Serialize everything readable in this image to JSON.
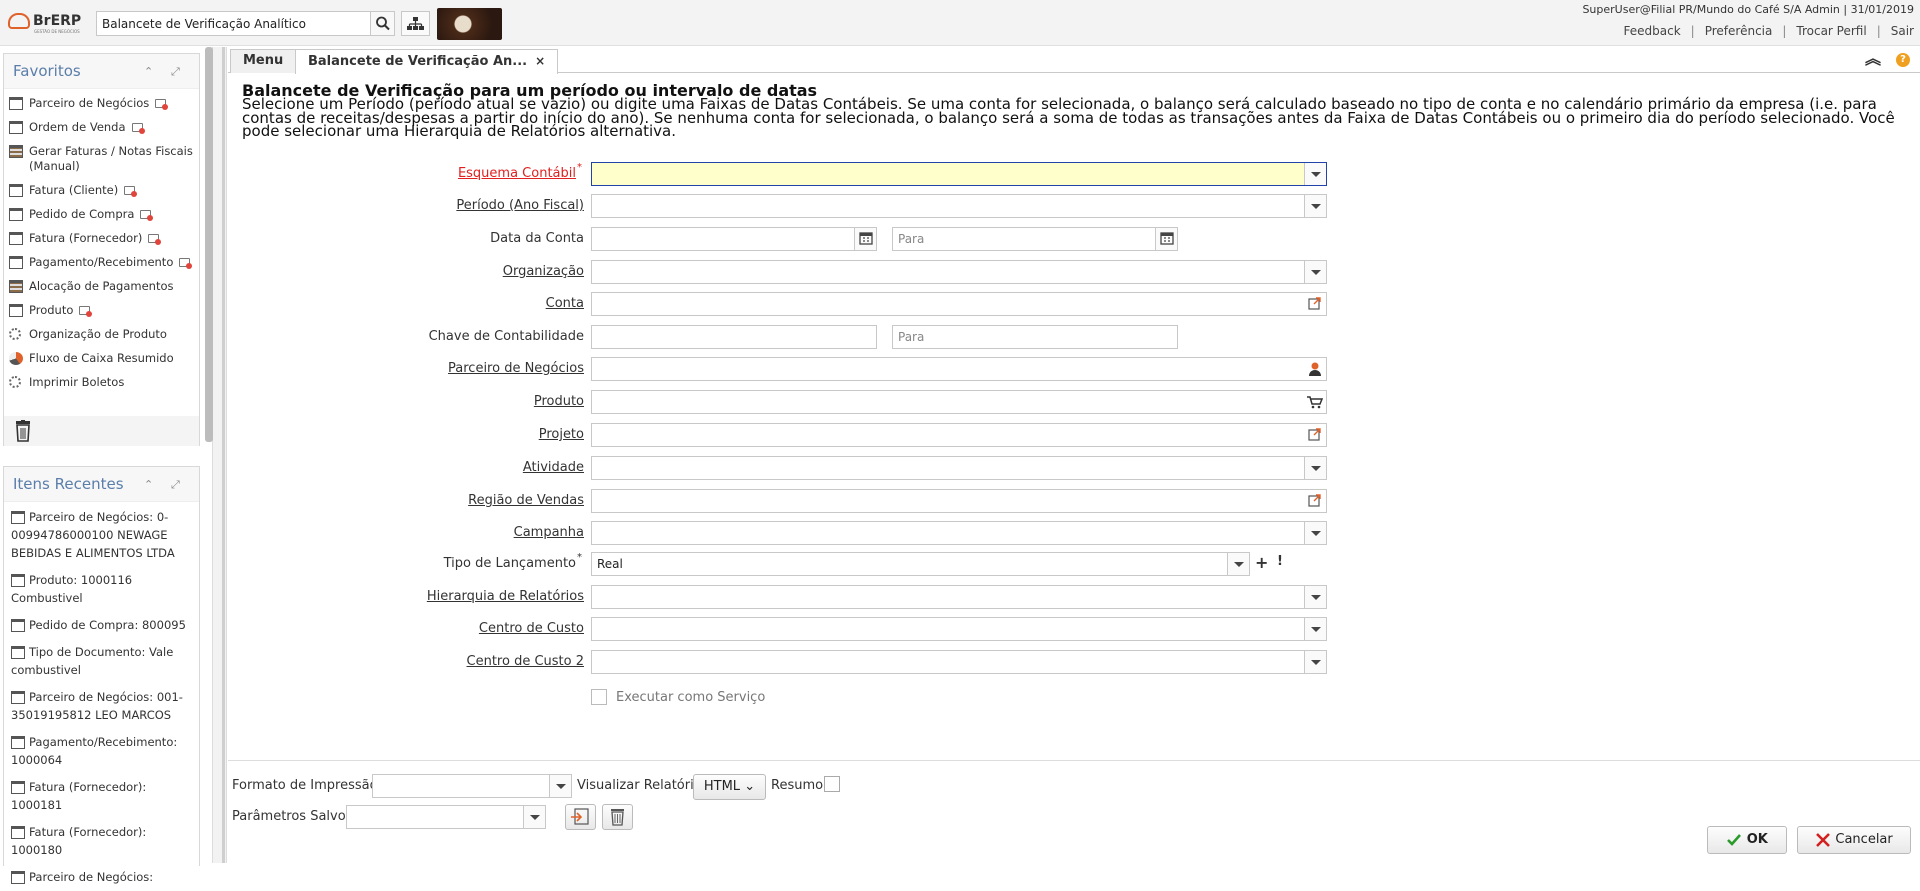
{
  "header": {
    "logo_text": "BrERP",
    "logo_subtext": "GESTÃO DE NEGÓCIOS",
    "search_value": "Balancete de Verificação Analítico",
    "user_info": "SuperUser@Filial PR/Mundo do Café S/A Admin | 31/01/2019",
    "links": [
      "Feedback",
      "Preferência",
      "Trocar Perfil",
      "Sair"
    ],
    "separator": "|"
  },
  "favorites": {
    "title": "Favoritos",
    "items": [
      {
        "label": "Parceiro de Negócios",
        "icon": "window-icon"
      },
      {
        "label": "Ordem de Venda",
        "icon": "window-icon"
      },
      {
        "label": "Gerar Faturas / Notas Fiscais (Manual)",
        "icon": "form-icon"
      },
      {
        "label": "Fatura (Cliente)",
        "icon": "window-icon"
      },
      {
        "label": "Pedido de Compra",
        "icon": "window-icon"
      },
      {
        "label": "Fatura (Fornecedor)",
        "icon": "window-icon"
      },
      {
        "label": "Pagamento/Recebimento",
        "icon": "window-icon"
      },
      {
        "label": "Alocação de Pagamentos",
        "icon": "form-icon"
      },
      {
        "label": "Produto",
        "icon": "window-icon"
      },
      {
        "label": "Organização de Produto",
        "icon": "process-gear-icon"
      },
      {
        "label": "Fluxo de Caixa Resumido",
        "icon": "report-pie-icon"
      },
      {
        "label": "Imprimir Boletos",
        "icon": "process-gear-icon"
      }
    ]
  },
  "recent": {
    "title": "Itens Recentes",
    "items": [
      "Parceiro de Negócios: 0-00994786000100 NEWAGE BEBIDAS E ALIMENTOS LTDA",
      "Produto: 1000116 Combustivel",
      "Pedido de Compra: 800095",
      "Tipo de Documento: Vale combustivel",
      "Parceiro de Negócios: 001-35019195812 LEO MARCOS",
      "Pagamento/Recebimento: 1000064",
      "Fatura (Fornecedor): 1000181",
      "Fatura (Fornecedor): 1000180",
      "Parceiro de Negócios:"
    ]
  },
  "tabs": [
    {
      "label": "Menu"
    },
    {
      "label": "Balancete de Verificação An..."
    }
  ],
  "close_glyph": "×",
  "help_glyph": "?",
  "collapse_glyph": "︽",
  "description": {
    "title": "Balancete de Verificação para um período ou intervalo de datas",
    "text": "Selecione um Período (período atual se vazio) ou digite uma Faixas de Datas Contábeis. Se uma conta for selecionada, o balanço será calculado baseado no tipo de conta e no calendário primário da empresa (i.e. para contas de receitas/despesas a partir do início do ano). Se nenhuma conta for selecionada, o balanço será a soma de todas as transações antes da Faixa de Datas Contábeis ou o primeiro dia do período selecionado. Você pode selecionar uma Hierarquia de Relatórios alternativa."
  },
  "form": {
    "esquema": "Esquema Contábil",
    "periodo": "Período (Ano Fiscal)",
    "data_conta": "Data da Conta",
    "para_placeholder": "Para",
    "organizacao": "Organização",
    "conta": "Conta",
    "chave": "Chave de Contabilidade",
    "parceiro": "Parceiro de Negócios",
    "produto": "Produto",
    "projeto": "Projeto",
    "atividade": "Atividade",
    "regiao": "Região de Vendas",
    "campanha": "Campanha",
    "tipo": "Tipo de Lançamento",
    "tipo_value": "Real",
    "hierarquia": "Hierarquia de Relatórios",
    "centro": "Centro de Custo",
    "centro2": "Centro de Custo 2",
    "executar": "Executar como Serviço",
    "required_mark": "*",
    "plus_glyph": "+",
    "bang_glyph": "!"
  },
  "bottom": {
    "formato": "Formato de Impressão",
    "visualizar": "Visualizar Relatório",
    "html_option": "HTML",
    "resumo": "Resumo",
    "parametros": "Parâmetros Salvos",
    "ok": "OK",
    "cancelar": "Cancelar"
  },
  "colors": {
    "accent": "#e0622b",
    "panel_title": "#5a7eaa",
    "mandatory": "#e02020",
    "mandatory_field_bg": "#ffffcc",
    "ok_check": "#2a9a2a",
    "cancel_x": "#d22020"
  }
}
